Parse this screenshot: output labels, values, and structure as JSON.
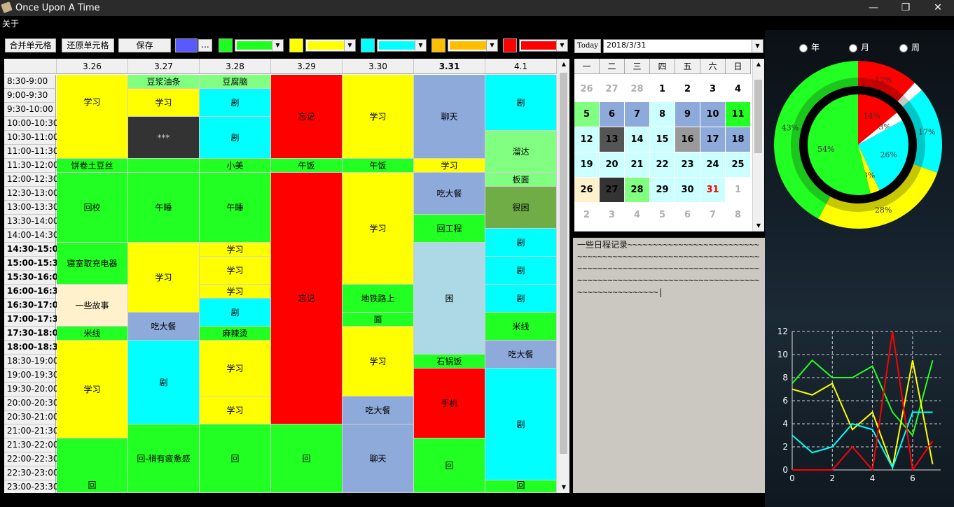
{
  "window": {
    "title": "Once Upon A Time",
    "min_glyph": "—",
    "max_glyph": "❐",
    "close_glyph": "✕"
  },
  "menu": {
    "about": "关于"
  },
  "toolbar": {
    "merge_label": "合并单元格",
    "restore_label": "还原单元格",
    "save_label": "保存",
    "more_label": "...",
    "swatch_colors": [
      "#5959ff",
      "#1fff1f",
      "#ffff00",
      "#00ffff",
      "#ffbf00",
      "#ff0000"
    ]
  },
  "date_picker": {
    "today_label": "Today",
    "date_value": "2018/3/31"
  },
  "schedule": {
    "columns": [
      {
        "label": "3.26",
        "bold": false
      },
      {
        "label": "3.27",
        "bold": false
      },
      {
        "label": "3.28",
        "bold": false
      },
      {
        "label": "3.29",
        "bold": false
      },
      {
        "label": "3.30",
        "bold": false
      },
      {
        "label": "3.31",
        "bold": true
      },
      {
        "label": "4.1",
        "bold": false
      }
    ],
    "times": [
      {
        "t": "8:30-9:00",
        "b": false
      },
      {
        "t": "9:00-9:30",
        "b": false
      },
      {
        "t": "9:30-10:00",
        "b": false
      },
      {
        "t": "10:00-10:30",
        "b": false
      },
      {
        "t": "10:30-11:00",
        "b": false
      },
      {
        "t": "11:00-11:30",
        "b": false
      },
      {
        "t": "11:30-12:00",
        "b": false
      },
      {
        "t": "12:00-12:30",
        "b": false
      },
      {
        "t": "12:30-13:00",
        "b": false
      },
      {
        "t": "13:00-13:30",
        "b": false
      },
      {
        "t": "13:30-14:00",
        "b": false
      },
      {
        "t": "14:00-14:30",
        "b": false
      },
      {
        "t": "14:30-15:00",
        "b": true
      },
      {
        "t": "15:00-15:30",
        "b": true
      },
      {
        "t": "15:30-16:00",
        "b": true
      },
      {
        "t": "16:00-16:30",
        "b": true
      },
      {
        "t": "16:30-17:00",
        "b": true
      },
      {
        "t": "17:00-17:30",
        "b": true
      },
      {
        "t": "17:30-18:00",
        "b": true
      },
      {
        "t": "18:00-18:30",
        "b": true
      },
      {
        "t": "18:30-19:00",
        "b": false
      },
      {
        "t": "19:00-19:30",
        "b": false
      },
      {
        "t": "19:30-20:00",
        "b": false
      },
      {
        "t": "20:00-20:30",
        "b": false
      },
      {
        "t": "20:30-21:00",
        "b": false
      },
      {
        "t": "21:00-21:30",
        "b": false
      },
      {
        "t": "21:30-22:00",
        "b": false
      },
      {
        "t": "22:00-22:30",
        "b": false
      },
      {
        "t": "22:30-23:00",
        "b": false
      },
      {
        "t": "23:00-23:30",
        "b": false
      }
    ],
    "events": [
      {
        "col": 0,
        "row": 0,
        "span": 6,
        "text": "学习",
        "color": "#ffff00",
        "valign": "top"
      },
      {
        "col": 0,
        "row": 6,
        "span": 1,
        "text": "饼卷土豆丝",
        "color": "#22ff22"
      },
      {
        "col": 0,
        "row": 7,
        "span": 5,
        "text": "回校",
        "color": "#22ff22"
      },
      {
        "col": 0,
        "row": 12,
        "span": 3,
        "text": "寝室取充电器",
        "color": "#22ff22"
      },
      {
        "col": 0,
        "row": 15,
        "span": 3,
        "text": "一些故事",
        "color": "#fff1cc"
      },
      {
        "col": 0,
        "row": 18,
        "span": 1,
        "text": "米线",
        "color": "#22ff22"
      },
      {
        "col": 0,
        "row": 19,
        "span": 7,
        "text": "学习",
        "color": "#ffff00"
      },
      {
        "col": 0,
        "row": 26,
        "span": 4,
        "text": "回",
        "color": "#22ff22",
        "valign": "bottom"
      },
      {
        "col": 1,
        "row": 0,
        "span": 1,
        "text": "豆浆油条",
        "color": "#80ff80"
      },
      {
        "col": 1,
        "row": 1,
        "span": 2,
        "text": "学习",
        "color": "#ffff00"
      },
      {
        "col": 1,
        "row": 3,
        "span": 3,
        "text": "***",
        "color": "#333333",
        "textcolor": "#cccccc"
      },
      {
        "col": 1,
        "row": 6,
        "span": 1,
        "text": "",
        "color": "#22ff22"
      },
      {
        "col": 1,
        "row": 7,
        "span": 5,
        "text": "午睡",
        "color": "#22ff22"
      },
      {
        "col": 1,
        "row": 12,
        "span": 5,
        "text": "学习",
        "color": "#ffff00"
      },
      {
        "col": 1,
        "row": 17,
        "span": 2,
        "text": "吃大餐",
        "color": "#8eaadb"
      },
      {
        "col": 1,
        "row": 19,
        "span": 6,
        "text": "剧",
        "color": "#00ffff"
      },
      {
        "col": 1,
        "row": 25,
        "span": 5,
        "text": "回-稍有疲惫感",
        "color": "#22ff22"
      },
      {
        "col": 2,
        "row": 0,
        "span": 1,
        "text": "豆腐脑",
        "color": "#80ff80"
      },
      {
        "col": 2,
        "row": 1,
        "span": 2,
        "text": "剧",
        "color": "#00ffff"
      },
      {
        "col": 2,
        "row": 3,
        "span": 3,
        "text": "剧",
        "color": "#00ffff"
      },
      {
        "col": 2,
        "row": 6,
        "span": 1,
        "text": "小美",
        "color": "#22ff22"
      },
      {
        "col": 2,
        "row": 7,
        "span": 5,
        "text": "午睡",
        "color": "#22ff22"
      },
      {
        "col": 2,
        "row": 12,
        "span": 1,
        "text": "学习",
        "color": "#ffff00"
      },
      {
        "col": 2,
        "row": 13,
        "span": 2,
        "text": "学习",
        "color": "#ffff00"
      },
      {
        "col": 2,
        "row": 15,
        "span": 1,
        "text": "学习",
        "color": "#ffff00"
      },
      {
        "col": 2,
        "row": 16,
        "span": 2,
        "text": "剧",
        "color": "#00ffff"
      },
      {
        "col": 2,
        "row": 18,
        "span": 1,
        "text": "麻辣烫",
        "color": "#22ff22"
      },
      {
        "col": 2,
        "row": 19,
        "span": 4,
        "text": "学习",
        "color": "#ffff00"
      },
      {
        "col": 2,
        "row": 23,
        "span": 2,
        "text": "学习",
        "color": "#ffff00"
      },
      {
        "col": 2,
        "row": 25,
        "span": 5,
        "text": "回",
        "color": "#22ff22"
      },
      {
        "col": 3,
        "row": 0,
        "span": 6,
        "text": "忘记",
        "color": "#ff0000"
      },
      {
        "col": 3,
        "row": 6,
        "span": 1,
        "text": "午饭",
        "color": "#22ff22"
      },
      {
        "col": 3,
        "row": 7,
        "span": 18,
        "text": "忘记",
        "color": "#ff0000"
      },
      {
        "col": 3,
        "row": 25,
        "span": 5,
        "text": "回",
        "color": "#22ff22"
      },
      {
        "col": 4,
        "row": 0,
        "span": 6,
        "text": "学习",
        "color": "#ffff00"
      },
      {
        "col": 4,
        "row": 6,
        "span": 1,
        "text": "午饭",
        "color": "#22ff22"
      },
      {
        "col": 4,
        "row": 7,
        "span": 8,
        "text": "学习",
        "color": "#ffff00"
      },
      {
        "col": 4,
        "row": 15,
        "span": 2,
        "text": "地铁路上",
        "color": "#22ff22"
      },
      {
        "col": 4,
        "row": 17,
        "span": 1,
        "text": "面",
        "color": "#22ff22"
      },
      {
        "col": 4,
        "row": 18,
        "span": 5,
        "text": "学习",
        "color": "#ffff00"
      },
      {
        "col": 4,
        "row": 23,
        "span": 2,
        "text": "吃大餐",
        "color": "#8eaadb"
      },
      {
        "col": 4,
        "row": 25,
        "span": 5,
        "text": "聊天",
        "color": "#8eaadb"
      },
      {
        "col": 5,
        "row": 0,
        "span": 6,
        "text": "聊天",
        "color": "#8eaadb"
      },
      {
        "col": 5,
        "row": 6,
        "span": 1,
        "text": "学习",
        "color": "#ffff00"
      },
      {
        "col": 5,
        "row": 7,
        "span": 3,
        "text": "吃大餐",
        "color": "#8eaadb"
      },
      {
        "col": 5,
        "row": 10,
        "span": 2,
        "text": "回工程",
        "color": "#22ff22"
      },
      {
        "col": 5,
        "row": 12,
        "span": 8,
        "text": "困",
        "color": "#add8e6"
      },
      {
        "col": 5,
        "row": 20,
        "span": 1,
        "text": "石锅饭",
        "color": "#22ff22"
      },
      {
        "col": 5,
        "row": 21,
        "span": 5,
        "text": "手机",
        "color": "#ff0000"
      },
      {
        "col": 5,
        "row": 26,
        "span": 4,
        "text": "回",
        "color": "#22ff22"
      },
      {
        "col": 6,
        "row": 0,
        "span": 4,
        "text": "剧",
        "color": "#00ffff"
      },
      {
        "col": 6,
        "row": 4,
        "span": 3,
        "text": "溜达",
        "color": "#80ff80"
      },
      {
        "col": 6,
        "row": 7,
        "span": 1,
        "text": "板面",
        "color": "#80ff80"
      },
      {
        "col": 6,
        "row": 8,
        "span": 3,
        "text": "很困",
        "color": "#70ad47"
      },
      {
        "col": 6,
        "row": 11,
        "span": 2,
        "text": "剧",
        "color": "#00ffff"
      },
      {
        "col": 6,
        "row": 13,
        "span": 2,
        "text": "剧",
        "color": "#00ffff"
      },
      {
        "col": 6,
        "row": 15,
        "span": 2,
        "text": "剧",
        "color": "#00ffff"
      },
      {
        "col": 6,
        "row": 17,
        "span": 2,
        "text": "米线",
        "color": "#22ff22"
      },
      {
        "col": 6,
        "row": 19,
        "span": 2,
        "text": "吃大餐",
        "color": "#8eaadb"
      },
      {
        "col": 6,
        "row": 21,
        "span": 8,
        "text": "剧",
        "color": "#00ffff"
      },
      {
        "col": 6,
        "row": 29,
        "span": 1,
        "text": "回",
        "color": "#22ff22",
        "valign": "bottom"
      }
    ]
  },
  "calendar": {
    "weekdays": [
      "一",
      "二",
      "三",
      "四",
      "五",
      "六",
      "日"
    ],
    "weeks": [
      [
        {
          "d": "26",
          "bg": "#ffffff",
          "fg": "#b0b0b0"
        },
        {
          "d": "27",
          "bg": "#ffffff",
          "fg": "#b0b0b0"
        },
        {
          "d": "28",
          "bg": "#ffffff",
          "fg": "#b0b0b0"
        },
        {
          "d": "1",
          "bg": "#ffffff",
          "fg": "#000"
        },
        {
          "d": "2",
          "bg": "#ffffff",
          "fg": "#000"
        },
        {
          "d": "3",
          "bg": "#ffffff",
          "fg": "#000"
        },
        {
          "d": "4",
          "bg": "#ffffff",
          "fg": "#000"
        }
      ],
      [
        {
          "d": "5",
          "bg": "#80ff80",
          "fg": "#000"
        },
        {
          "d": "6",
          "bg": "#8eaadb",
          "fg": "#000"
        },
        {
          "d": "7",
          "bg": "#8eaadb",
          "fg": "#000"
        },
        {
          "d": "8",
          "bg": "#ccffff",
          "fg": "#000"
        },
        {
          "d": "9",
          "bg": "#8eaadb",
          "fg": "#000"
        },
        {
          "d": "10",
          "bg": "#8eaadb",
          "fg": "#000"
        },
        {
          "d": "11",
          "bg": "#22ff22",
          "fg": "#000"
        }
      ],
      [
        {
          "d": "12",
          "bg": "#ccffff",
          "fg": "#000"
        },
        {
          "d": "13",
          "bg": "#555555",
          "fg": "#000"
        },
        {
          "d": "14",
          "bg": "#ccffff",
          "fg": "#000"
        },
        {
          "d": "15",
          "bg": "#ccffff",
          "fg": "#000"
        },
        {
          "d": "16",
          "bg": "#999999",
          "fg": "#000"
        },
        {
          "d": "17",
          "bg": "#8eaadb",
          "fg": "#000"
        },
        {
          "d": "18",
          "bg": "#8eaadb",
          "fg": "#000"
        }
      ],
      [
        {
          "d": "19",
          "bg": "#ccffff",
          "fg": "#000"
        },
        {
          "d": "20",
          "bg": "#ccffff",
          "fg": "#000"
        },
        {
          "d": "21",
          "bg": "#ccffff",
          "fg": "#000"
        },
        {
          "d": "22",
          "bg": "#ccffff",
          "fg": "#000"
        },
        {
          "d": "23",
          "bg": "#ccffff",
          "fg": "#000"
        },
        {
          "d": "24",
          "bg": "#ccffff",
          "fg": "#000"
        },
        {
          "d": "25",
          "bg": "#ccffff",
          "fg": "#000"
        }
      ],
      [
        {
          "d": "26",
          "bg": "#fff1cc",
          "fg": "#000"
        },
        {
          "d": "27",
          "bg": "#333333",
          "fg": "#000"
        },
        {
          "d": "28",
          "bg": "#80ff80",
          "fg": "#000"
        },
        {
          "d": "29",
          "bg": "#ccffff",
          "fg": "#000"
        },
        {
          "d": "30",
          "bg": "#ccffff",
          "fg": "#000"
        },
        {
          "d": "31",
          "bg": "#ccffff",
          "fg": "#ff0000"
        },
        {
          "d": "1",
          "bg": "#ffffff",
          "fg": "#b0b0b0"
        }
      ],
      [
        {
          "d": "2",
          "bg": "#ffffff",
          "fg": "#b0b0b0"
        },
        {
          "d": "3",
          "bg": "#ffffff",
          "fg": "#b0b0b0"
        },
        {
          "d": "4",
          "bg": "#ffffff",
          "fg": "#b0b0b0"
        },
        {
          "d": "5",
          "bg": "#ffffff",
          "fg": "#b0b0b0"
        },
        {
          "d": "6",
          "bg": "#ffffff",
          "fg": "#b0b0b0"
        },
        {
          "d": "7",
          "bg": "#ffffff",
          "fg": "#b0b0b0"
        },
        {
          "d": "8",
          "bg": "#ffffff",
          "fg": "#b0b0b0"
        }
      ]
    ]
  },
  "notes": {
    "text": "一些日程记录~~~~~~~~~~~~~~~~~~~~~~~~~~~~~~~~~~~~~~~~~~~~~~~~~~~~~~~~~~~~~~~~~~~~~~~~~~~~~~~~~~~~~~~~~~~~~~~~~~~~~~~~~~~~~~~~~~~~~~~~~~~~~~~~~~~~~~~~~~~~~~~~~~~~~~|"
  },
  "period": {
    "year": "年",
    "month": "月",
    "week": "周"
  },
  "chart_data": [
    {
      "type": "pie",
      "rings": [
        {
          "name": "outer",
          "slices": [
            {
              "label": "12%",
              "value": 12,
              "color": "#ff0000"
            },
            {
              "label": "",
              "value": 2,
              "color": "#ffffff"
            },
            {
              "label": "17%",
              "value": 17,
              "color": "#00ffff"
            },
            {
              "label": "28%",
              "value": 28,
              "color": "#ffff00"
            },
            {
              "label": "43%",
              "value": 43,
              "color": "#22ff22"
            }
          ]
        },
        {
          "name": "inner",
          "slices": [
            {
              "label": "14%",
              "value": 14,
              "color": "#ff0000"
            },
            {
              "label": "3%",
              "value": 3,
              "color": "#ffffff"
            },
            {
              "label": "26%",
              "value": 26,
              "color": "#00ffff"
            },
            {
              "label": "3%",
              "value": 3,
              "color": "#ffff00"
            },
            {
              "label": "54%",
              "value": 54,
              "color": "#22ff22"
            }
          ]
        }
      ]
    },
    {
      "type": "line",
      "x": [
        0,
        1,
        2,
        3,
        4,
        5,
        6,
        7
      ],
      "xticks": [
        "0",
        "2",
        "4",
        "6"
      ],
      "yticks": [
        "0",
        "2",
        "4",
        "6",
        "8",
        "10",
        "12"
      ],
      "xlim": [
        0,
        7.4
      ],
      "ylim": [
        0,
        12
      ],
      "grid": true,
      "series": [
        {
          "color": "#22ff22",
          "values": [
            7.5,
            9.5,
            8,
            8,
            9,
            5,
            3,
            9.5
          ]
        },
        {
          "color": "#ffff00",
          "values": [
            7,
            6.5,
            7.5,
            3.5,
            5,
            0.2,
            9.5,
            0.5
          ]
        },
        {
          "color": "#00ffff",
          "values": [
            3,
            1.5,
            2,
            4,
            3.5,
            0.2,
            5,
            5
          ]
        },
        {
          "color": "#ff0000",
          "values": [
            0,
            0,
            0,
            2,
            0,
            12,
            0,
            2.5
          ]
        }
      ]
    }
  ]
}
